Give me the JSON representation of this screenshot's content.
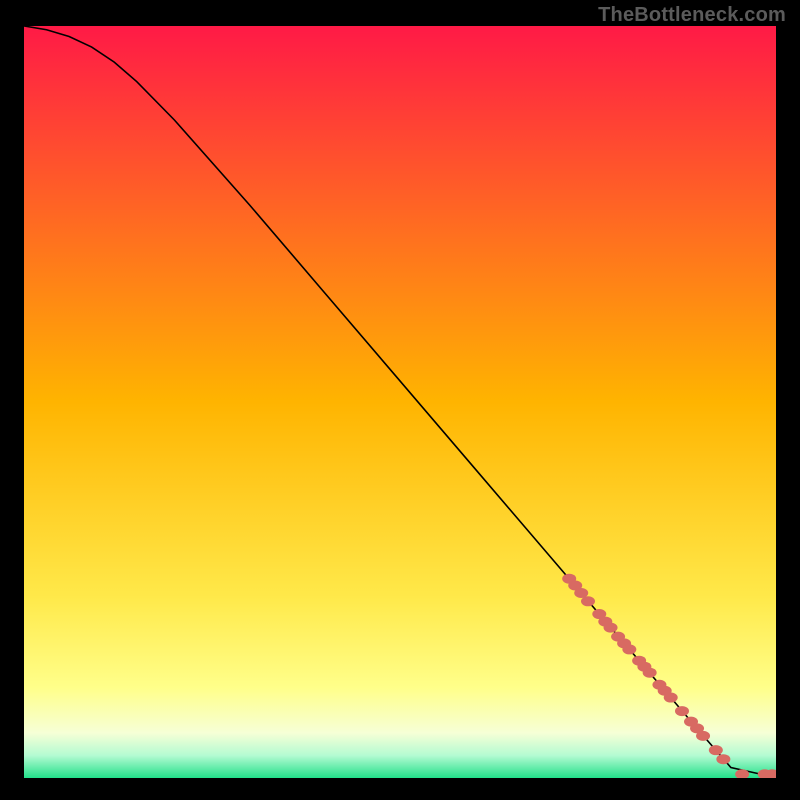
{
  "watermark": "TheBottleneck.com",
  "chart_data": {
    "type": "line",
    "title": "",
    "xlabel": "",
    "ylabel": "",
    "xlim": [
      0,
      100
    ],
    "ylim": [
      0,
      100
    ],
    "grid": false,
    "legend": false,
    "background_gradient": {
      "stops": [
        {
          "offset": 0.0,
          "color": "#ff1a46"
        },
        {
          "offset": 0.5,
          "color": "#ffb400"
        },
        {
          "offset": 0.76,
          "color": "#ffe94a"
        },
        {
          "offset": 0.88,
          "color": "#ffff8a"
        },
        {
          "offset": 0.94,
          "color": "#f6ffd6"
        },
        {
          "offset": 0.97,
          "color": "#b4fbd2"
        },
        {
          "offset": 1.0,
          "color": "#22e08a"
        }
      ]
    },
    "series": [
      {
        "name": "bottleneck-curve",
        "type": "line",
        "color": "#000000",
        "x": [
          0,
          3,
          6,
          9,
          12,
          15,
          20,
          30,
          40,
          50,
          60,
          70,
          80,
          86,
          90,
          94,
          98,
          100
        ],
        "y": [
          100,
          99.5,
          98.6,
          97.2,
          95.2,
          92.6,
          87.5,
          76.2,
          64.5,
          52.8,
          41.1,
          29.4,
          17.7,
          10.7,
          6.0,
          1.4,
          0.5,
          0.5
        ]
      },
      {
        "name": "highlight-markers",
        "type": "scatter",
        "color": "#d86a62",
        "x": [
          72.5,
          73.3,
          74.1,
          75.0,
          76.5,
          77.3,
          78.0,
          79.0,
          79.8,
          80.5,
          81.8,
          82.5,
          83.2,
          84.5,
          85.2,
          86.0,
          87.5,
          88.7,
          89.5,
          90.3,
          92.0,
          93.0,
          95.5,
          98.5,
          99.5
        ],
        "y": [
          26.5,
          25.6,
          24.6,
          23.5,
          21.8,
          20.8,
          20.0,
          18.8,
          17.9,
          17.1,
          15.6,
          14.8,
          14.0,
          12.4,
          11.6,
          10.7,
          8.9,
          7.5,
          6.6,
          5.6,
          3.7,
          2.5,
          0.5,
          0.5,
          0.5
        ]
      }
    ]
  }
}
